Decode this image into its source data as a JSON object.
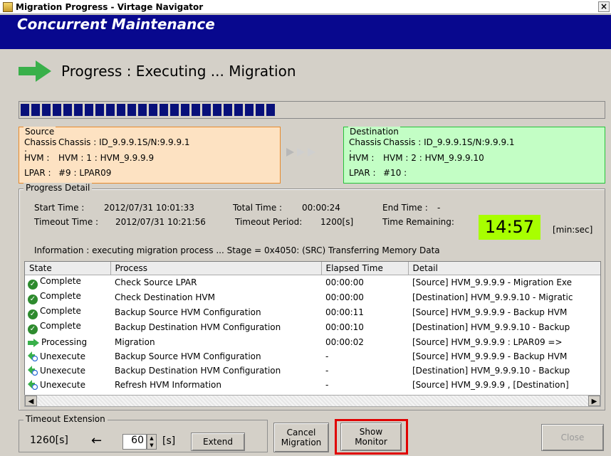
{
  "window": {
    "title": "Migration Progress - Virtage Navigator",
    "close": "×"
  },
  "banner": {
    "title": "Concurrent Maintenance"
  },
  "progress": {
    "label": "Progress : Executing ... Migration",
    "fraction": 0.48,
    "segments": 24
  },
  "source": {
    "legend": "Source",
    "rows": [
      {
        "key": "Chassis :",
        "value": "Chassis : ID_9.9.9.1S/N:9.9.9.1"
      },
      {
        "key": "HVM :",
        "value": "HVM : 1 : HVM_9.9.9.9"
      },
      {
        "key": "LPAR :",
        "value": "#9 : LPAR09"
      }
    ]
  },
  "destination": {
    "legend": "Destination",
    "rows": [
      {
        "key": "Chassis :",
        "value": "Chassis : ID_9.9.9.1S/N:9.9.9.1"
      },
      {
        "key": "HVM :",
        "value": "HVM : 2 : HVM_9.9.9.10"
      },
      {
        "key": "LPAR :",
        "value": "#10 :"
      }
    ]
  },
  "detail": {
    "legend": "Progress Detail",
    "start_label": "Start Time :",
    "start_value": "2012/07/31 10:01:33",
    "total_label": "Total Time :",
    "total_value": "00:00:24",
    "end_label": "End Time :",
    "end_value": "-",
    "timeout_label": "Timeout Time :",
    "timeout_value": "2012/07/31 10:21:56",
    "period_label": "Timeout Period:",
    "period_value": "1200[s]",
    "remaining_label": "Time Remaining:",
    "remaining_value": "14:57",
    "remaining_unit": "[min:sec]",
    "information": "Information : executing migration process ... Stage = 0x4050: (SRC) Transferring Memory Data"
  },
  "grid": {
    "headers": [
      "State",
      "Process",
      "Elapsed Time",
      "Detail"
    ],
    "rows": [
      {
        "icon": "check-circle-icon",
        "state": "Complete",
        "process": "Check Source LPAR",
        "elapsed": "00:00:00",
        "detail": "[Source] HVM_9.9.9.9 - Migration Exe"
      },
      {
        "icon": "check-circle-icon",
        "state": "Complete",
        "process": "Check Destination HVM",
        "elapsed": "00:00:00",
        "detail": "[Destination] HVM_9.9.9.10 - Migratic"
      },
      {
        "icon": "check-circle-icon",
        "state": "Complete",
        "process": "Backup Source HVM Configuration",
        "elapsed": "00:00:11",
        "detail": "[Source] HVM_9.9.9.9 - Backup HVM"
      },
      {
        "icon": "check-circle-icon",
        "state": "Complete",
        "process": "Backup Destination HVM Configuration",
        "elapsed": "00:00:10",
        "detail": "[Destination] HVM_9.9.9.10 - Backup"
      },
      {
        "icon": "arrow-right-icon",
        "state": "Processing",
        "process": "Migration",
        "elapsed": "00:00:02",
        "detail": "[Source] HVM_9.9.9.9 : LPAR09 =>"
      },
      {
        "icon": "pending-icon",
        "state": "Unexecute",
        "process": "Backup Source HVM Configuration",
        "elapsed": "-",
        "detail": "[Source] HVM_9.9.9.9 - Backup HVM"
      },
      {
        "icon": "pending-icon",
        "state": "Unexecute",
        "process": "Backup Destination HVM Configuration",
        "elapsed": "-",
        "detail": "[Destination] HVM_9.9.9.10 - Backup"
      },
      {
        "icon": "pending-icon",
        "state": "Unexecute",
        "process": "Refresh HVM Information",
        "elapsed": "-",
        "detail": "[Source] HVM_9.9.9.9 , [Destination]"
      }
    ]
  },
  "timeout_ext": {
    "legend": "Timeout Extension",
    "current": "1260[s]",
    "arrow": "←",
    "input_value": "60",
    "unit": "[s]",
    "extend_label": "Extend"
  },
  "buttons": {
    "cancel": "Cancel\nMigration",
    "show": "Show\nMonitor",
    "close": "Close"
  },
  "colors": {
    "banner": "#08088e",
    "source_bg": "#fde2c2",
    "dest_bg": "#c3fec5",
    "remaining_bg": "#a8ff00",
    "highlight": "#e00000"
  }
}
